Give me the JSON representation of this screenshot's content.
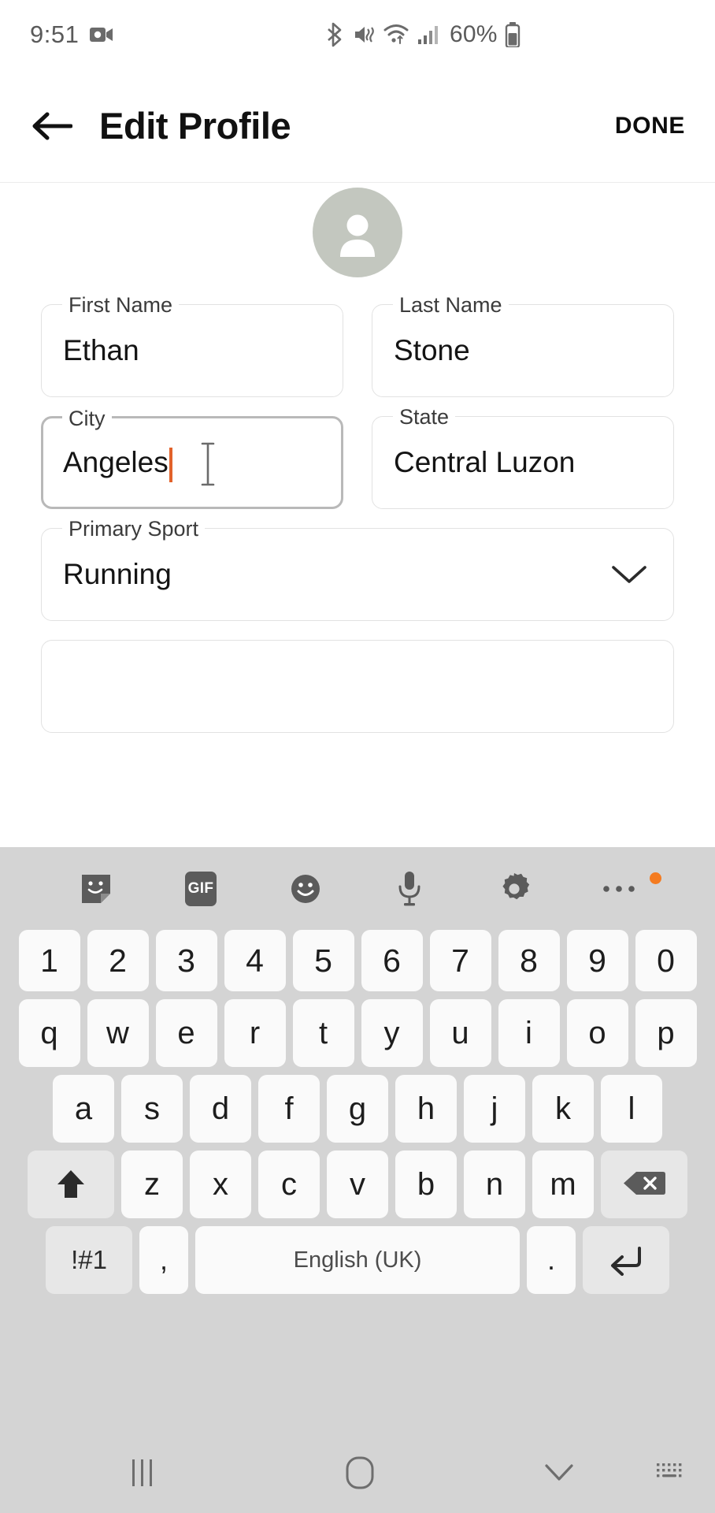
{
  "status_bar": {
    "time": "9:51",
    "battery_percent": "60%",
    "icons": [
      "video-camera-icon",
      "bluetooth-icon",
      "mute-vibrate-icon",
      "wifi-icon",
      "cellular-signal-icon",
      "battery-icon"
    ]
  },
  "app_bar": {
    "back_icon": "arrow-left-icon",
    "title": "Edit Profile",
    "done_label": "DONE"
  },
  "avatar": {
    "icon": "person-placeholder-icon",
    "background_color": "#c3c7bf"
  },
  "form": {
    "fields": [
      {
        "name": "first-name",
        "label": "First Name",
        "value": "Ethan",
        "placeholder": "",
        "focused": false,
        "type": "text"
      },
      {
        "name": "last-name",
        "label": "Last Name",
        "value": "Stone",
        "placeholder": "",
        "focused": false,
        "type": "text"
      },
      {
        "name": "city",
        "label": "City",
        "value": "Angeles",
        "placeholder": "",
        "focused": true,
        "type": "text"
      },
      {
        "name": "state",
        "label": "State",
        "value": "Central Luzon",
        "placeholder": "",
        "focused": false,
        "type": "text"
      },
      {
        "name": "primary-sport",
        "label": "Primary Sport",
        "value": "Running",
        "placeholder": "",
        "focused": false,
        "type": "select",
        "chevron": "chevron-down-icon"
      },
      {
        "name": "next-field-partial",
        "label": "",
        "value": "",
        "placeholder": "",
        "focused": false,
        "type": "text"
      }
    ],
    "caret_color": "#e2622a"
  },
  "keyboard": {
    "toolbar": [
      {
        "name": "sticker-icon",
        "label": ""
      },
      {
        "name": "gif-icon",
        "label": "GIF"
      },
      {
        "name": "emoji-icon",
        "label": ""
      },
      {
        "name": "microphone-icon",
        "label": ""
      },
      {
        "name": "gear-icon",
        "label": ""
      },
      {
        "name": "more-options-icon",
        "label": "",
        "badge": true
      }
    ],
    "row_numbers": [
      "1",
      "2",
      "3",
      "4",
      "5",
      "6",
      "7",
      "8",
      "9",
      "0"
    ],
    "row_top": [
      "q",
      "w",
      "e",
      "r",
      "t",
      "y",
      "u",
      "i",
      "o",
      "p"
    ],
    "row_home": [
      "a",
      "s",
      "d",
      "f",
      "g",
      "h",
      "j",
      "k",
      "l"
    ],
    "row_bottom": [
      "z",
      "x",
      "c",
      "v",
      "b",
      "n",
      "m"
    ],
    "shift_label": "",
    "backspace_label": "",
    "symbols_label": "!#1",
    "comma_label": ",",
    "space_label": "English (UK)",
    "period_label": ".",
    "enter_label": ""
  },
  "nav_bar": {
    "recents": "recents-icon",
    "home": "home-icon",
    "hide_keyboard": "chevron-down-icon",
    "switch_keyboard": "keyboard-switch-icon"
  }
}
